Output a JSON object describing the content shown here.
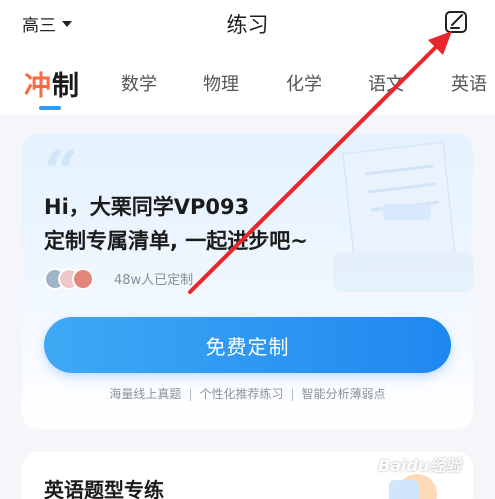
{
  "header": {
    "grade": "高三",
    "title": "练习"
  },
  "tabs": [
    {
      "label_first": "冲",
      "label_rest": "制",
      "active": true
    },
    {
      "label": "数学"
    },
    {
      "label": "物理"
    },
    {
      "label": "化学"
    },
    {
      "label": "语文"
    },
    {
      "label": "英语"
    }
  ],
  "promo_card": {
    "greeting_line1": "Hi，大栗同学VP093",
    "greeting_line2": "定制专属清单, 一起进步吧~",
    "customized_count": "48w人已定制",
    "cta_label": "免费定制",
    "features": [
      "海量线上真题",
      "个性化推荐练习",
      "智能分析薄弱点"
    ],
    "feature_separator": "|"
  },
  "second_card": {
    "title": "英语题型专练"
  },
  "watermark": "Baidu经验",
  "colors": {
    "accent_blue": "#1e88f0",
    "tab_highlight": "#ff6a3d",
    "annotation_arrow": "#e8262c"
  }
}
